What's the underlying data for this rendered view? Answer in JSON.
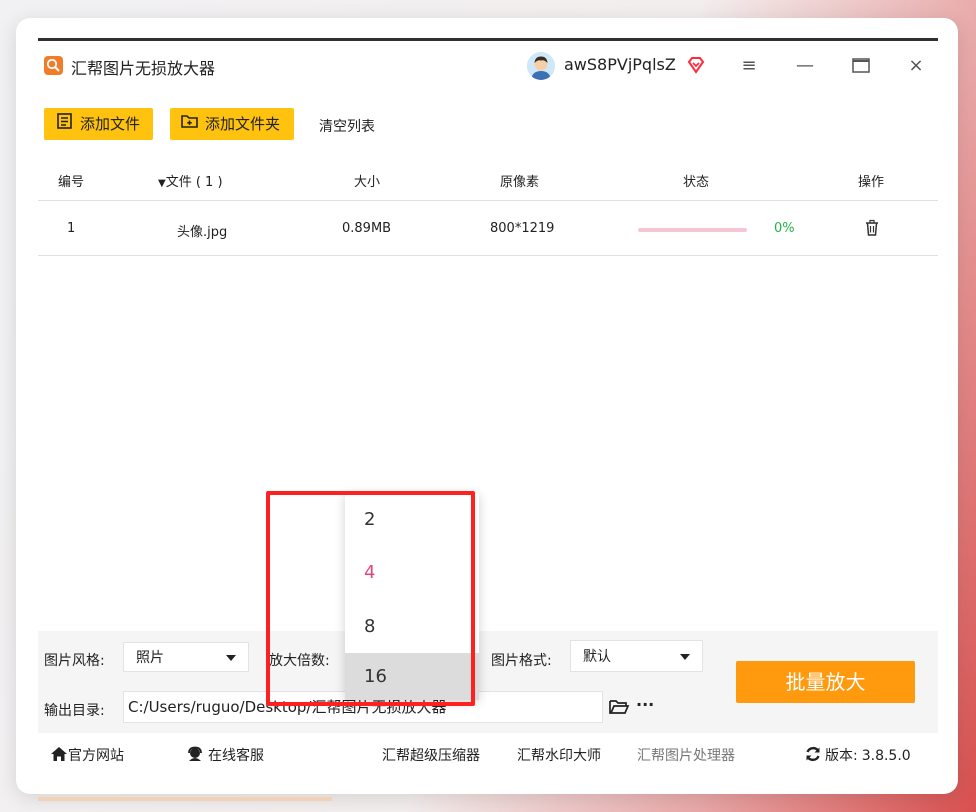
{
  "app": {
    "title": "汇帮图片无损放大器",
    "username": "awS8PVjPqlsZ",
    "win_controls": {
      "menu": "≡",
      "minimize": "—",
      "maximize": "□",
      "close": "×"
    }
  },
  "toolbar": {
    "add_file": "添加文件",
    "add_folder": "添加文件夹",
    "clear_list": "清空列表"
  },
  "table": {
    "headers": {
      "no": "编号",
      "file": "文件 ( 1 )",
      "size": "大小",
      "pixels": "原像素",
      "status": "状态",
      "action": "操作"
    },
    "rows": [
      {
        "no": "1",
        "file": "头像.jpg",
        "size": "0.89MB",
        "pixels": "800*1219",
        "progress": 0,
        "percent": "0%"
      }
    ]
  },
  "settings": {
    "style_label": "图片风格:",
    "style_value": "照片",
    "scale_label": "放大倍数:",
    "format_label": "图片格式:",
    "format_value": "默认",
    "output_label": "输出目录:",
    "output_path": "C:/Users/ruguo/Desktop/汇帮图片无损放大器",
    "more": "···",
    "batch_button": "批量放大"
  },
  "scale_dropdown": {
    "options": [
      "2",
      "4",
      "8",
      "16"
    ],
    "selected": "4",
    "hovered": "16"
  },
  "footer": {
    "website": "官方网站",
    "support": "在线客服",
    "compressor": "汇帮超级压缩器",
    "watermark": "汇帮水印大师",
    "processor": "汇帮图片处理器",
    "version_label": "版本:",
    "version": "3.8.5.0"
  },
  "colors": {
    "accent_yellow": "#ffc20e",
    "accent_orange": "#ff9a0e",
    "highlight_red": "#ff2020",
    "selected_pink": "#e6457a",
    "progress_green": "#24b24b"
  }
}
